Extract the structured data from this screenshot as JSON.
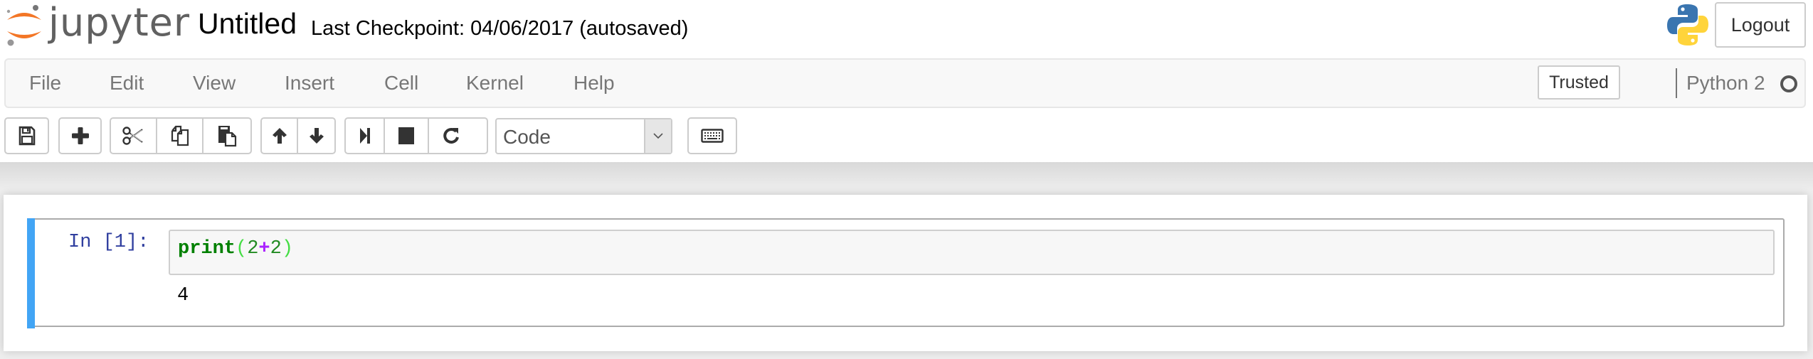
{
  "header": {
    "logo_text": "jupyter",
    "notebook_title": "Untitled",
    "checkpoint": "Last Checkpoint: 04/06/2017 (autosaved)",
    "logout_label": "Logout"
  },
  "menubar": {
    "items": [
      {
        "label": "File"
      },
      {
        "label": "Edit"
      },
      {
        "label": "View"
      },
      {
        "label": "Insert"
      },
      {
        "label": "Cell"
      },
      {
        "label": "Kernel"
      },
      {
        "label": "Help"
      }
    ],
    "trusted_label": "Trusted",
    "kernel_name": "Python 2",
    "kernel_status": "idle"
  },
  "toolbar": {
    "buttons": [
      {
        "icon": "save-icon",
        "title": "Save and Checkpoint"
      },
      {
        "icon": "plus-icon",
        "title": "Insert cell below"
      },
      {
        "icon": "cut-icon",
        "title": "Cut selected cells"
      },
      {
        "icon": "copy-icon",
        "title": "Copy selected cells"
      },
      {
        "icon": "paste-icon",
        "title": "Paste cells below"
      },
      {
        "icon": "arrow-up-icon",
        "title": "Move selected cells up"
      },
      {
        "icon": "arrow-down-icon",
        "title": "Move selected cells down"
      },
      {
        "icon": "step-forward-icon",
        "title": "Run cell"
      },
      {
        "icon": "stop-icon",
        "title": "Interrupt kernel"
      },
      {
        "icon": "restart-icon",
        "title": "Restart kernel"
      },
      {
        "icon": "keyboard-icon",
        "title": "Command palette"
      }
    ],
    "cell_type": "Code"
  },
  "notebook": {
    "cells": [
      {
        "prompt": "In [1]:",
        "code_tokens": [
          {
            "type": "builtin",
            "text": "print"
          },
          {
            "type": "paren",
            "text": "("
          },
          {
            "type": "num",
            "text": "2"
          },
          {
            "type": "op",
            "text": "+"
          },
          {
            "type": "num",
            "text": "2"
          },
          {
            "type": "paren",
            "text": ")"
          }
        ],
        "output": "4"
      }
    ]
  },
  "colors": {
    "logo_orange": "#f37626",
    "cell_selected_bar": "#42a5f5",
    "prompt_in": "#303f9f",
    "menubar_bg": "#f8f8f8"
  }
}
